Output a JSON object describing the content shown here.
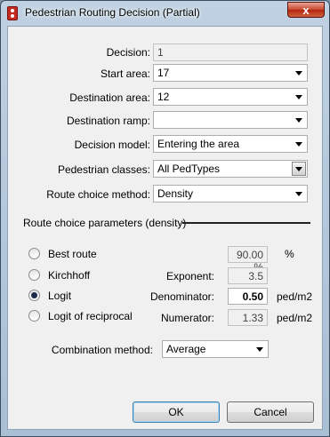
{
  "window": {
    "title": "Pedestrian Routing Decision (Partial)",
    "close_label": "x"
  },
  "form": {
    "decision": {
      "label": "Decision:",
      "value": "1"
    },
    "start_area": {
      "label": "Start area:",
      "value": "17"
    },
    "destination_area": {
      "label": "Destination area:",
      "value": "12"
    },
    "destination_ramp": {
      "label": "Destination ramp:",
      "value": ""
    },
    "decision_model": {
      "label": "Decision model:",
      "value": "Entering the area"
    },
    "pedestrian_classes": {
      "label": "Pedestrian classes:",
      "value": "All PedTypes"
    },
    "route_choice_method": {
      "label": "Route choice method:",
      "value": "Density"
    }
  },
  "params": {
    "section_title": "Route choice parameters (density)",
    "options": [
      {
        "label": "Best route",
        "checked": false
      },
      {
        "label": "Kirchhoff",
        "checked": false
      },
      {
        "label": "Logit",
        "checked": true
      },
      {
        "label": "Logit of reciprocal",
        "checked": false
      }
    ],
    "best_route_value": "90.00 %",
    "best_route_unit": "%",
    "exponent": {
      "label": "Exponent:",
      "value": "3.5"
    },
    "denominator": {
      "label": "Denominator:",
      "value": "0.50",
      "unit": "ped/m2"
    },
    "numerator": {
      "label": "Numerator:",
      "value": "1.33",
      "unit": "ped/m2"
    },
    "combination": {
      "label": "Combination method:",
      "value": "Average"
    }
  },
  "buttons": {
    "ok": "OK",
    "cancel": "Cancel"
  }
}
